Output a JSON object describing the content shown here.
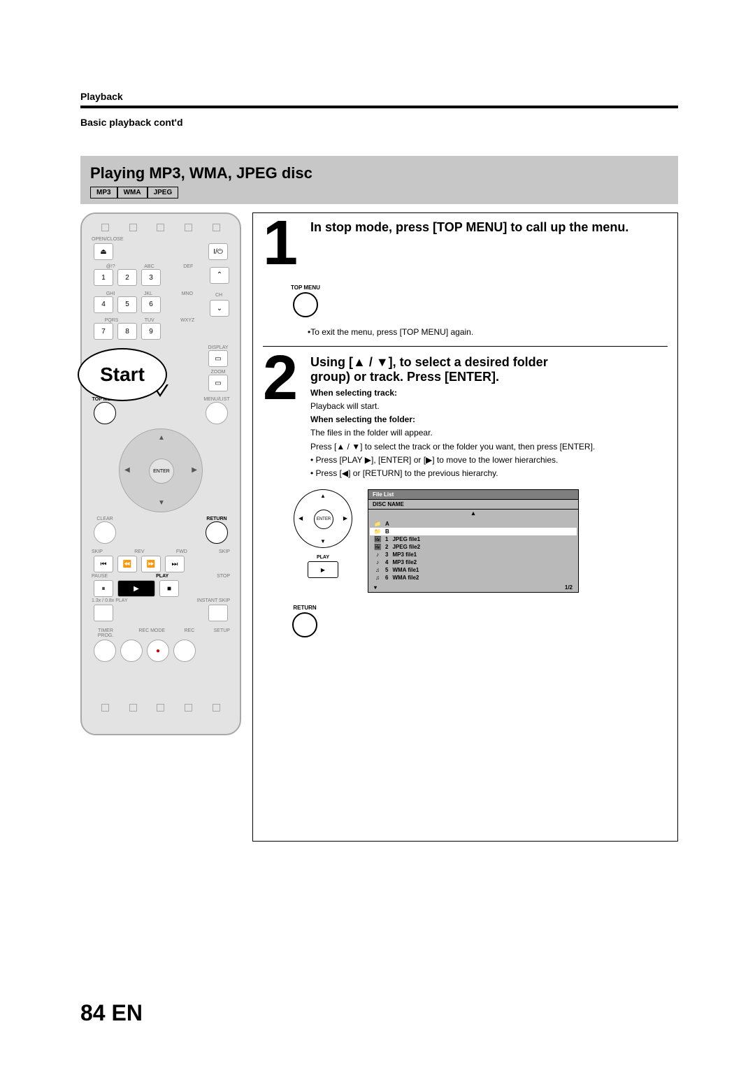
{
  "header": {
    "section": "Playback",
    "sub": "Basic playback cont'd"
  },
  "grayband": {
    "title": "Playing MP3, WMA, JPEG disc",
    "badges": [
      "MP3",
      "WMA",
      "JPEG"
    ]
  },
  "remote": {
    "open_close": "OPEN/CLOSE",
    "keys_row1_labels": [
      "@!?",
      "ABC",
      "DEF"
    ],
    "keys_row1": [
      "1",
      "2",
      "3"
    ],
    "keys_row2_labels": [
      "GHI",
      "JKL",
      "MNO"
    ],
    "keys_row2": [
      "4",
      "5",
      "6"
    ],
    "keys_row3_labels": [
      "PQRS",
      "TUV",
      "WXYZ"
    ],
    "keys_row3": [
      "7",
      "8",
      "9"
    ],
    "ch": "CH",
    "display": "DISPLAY",
    "zoom": "ZOOM",
    "top_menu": "TOP MENU",
    "menu_list": "MENU/LIST",
    "enter": "ENTER",
    "clear": "CLEAR",
    "return": "RETURN",
    "transport_labels": [
      "SKIP",
      "REV",
      "FWD",
      "SKIP"
    ],
    "transport2_labels": [
      "PAUSE",
      "PLAY",
      "STOP"
    ],
    "extra1": "1.3x / 0.8x PLAY",
    "extra2": "INSTANT SKIP",
    "bottom_labels": [
      "TIMER PROG.",
      "REC MODE",
      "REC",
      "SETUP"
    ],
    "start_bubble": "Start"
  },
  "step1": {
    "num": "1",
    "title": "In stop mode, press [TOP MENU] to call up the menu.",
    "topmenu_label": "TOP MENU",
    "exit_note": "•To exit the menu, press [TOP MENU] again."
  },
  "step2": {
    "num": "2",
    "title_a": "Using [▲ / ▼], to select a desired folder",
    "title_b": "group) or track. Press [ENTER].",
    "sel_track_head": "When selecting track:",
    "sel_track_body": "Playback will start.",
    "sel_folder_head": "When selecting the folder:",
    "sel_folder_body": "The files in the folder will appear.",
    "press_select": "Press [▲ / ▼] to select the track or the folder you want, then press [ENTER].",
    "bullet_play": "• Press [PLAY ▶], [ENTER] or [▶] to move to the lower hierarchies.",
    "bullet_return": "• Press [◀] or [RETURN] to the previous hierarchy.",
    "ctrl_enter": "ENTER",
    "ctrl_play_label": "PLAY",
    "ctrl_return_label": "RETURN"
  },
  "filelist": {
    "head": "File List",
    "sub": "DISC NAME",
    "rows": [
      {
        "icon": "📁",
        "idx": "",
        "name": "A"
      },
      {
        "icon": "📁",
        "idx": "",
        "name": "B"
      },
      {
        "icon": "🖼",
        "idx": "1",
        "name": "JPEG file1"
      },
      {
        "icon": "🖼",
        "idx": "2",
        "name": "JPEG file2"
      },
      {
        "icon": "♪",
        "idx": "3",
        "name": "MP3 file1"
      },
      {
        "icon": "♪",
        "idx": "4",
        "name": "MP3 file2"
      },
      {
        "icon": "♫",
        "idx": "5",
        "name": "WMA file1"
      },
      {
        "icon": "♫",
        "idx": "6",
        "name": "WMA file2"
      }
    ],
    "page": "1/2"
  },
  "footer": {
    "page": "84",
    "lang": "EN"
  }
}
